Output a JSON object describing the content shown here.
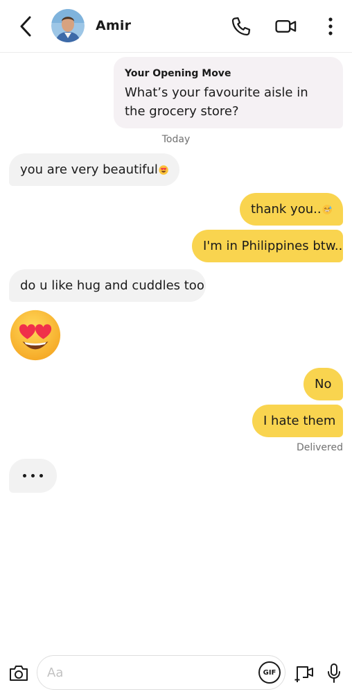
{
  "header": {
    "contact_name": "Amir",
    "icons": {
      "back": "chevron-left-icon",
      "call": "phone-icon",
      "video": "video-camera-icon",
      "more": "more-vertical-icon"
    }
  },
  "opening_move": {
    "label": "Your Opening Move",
    "question": "What’s your favourite aisle in the grocery store?"
  },
  "date_separator": "Today",
  "messages": [
    {
      "direction": "incoming",
      "text": "you are very beautiful",
      "emoji": "heart-eyes"
    },
    {
      "direction": "outgoing",
      "text": "thank you..",
      "emoji": "grinning-sweat"
    },
    {
      "direction": "outgoing",
      "text": "I'm in Philippines btw.."
    },
    {
      "direction": "incoming",
      "text": "do u like hug and cuddles too"
    },
    {
      "direction": "incoming",
      "emoji": "heart-eyes",
      "large": true
    },
    {
      "direction": "outgoing",
      "text": "No"
    },
    {
      "direction": "outgoing",
      "text": "I hate them"
    }
  ],
  "status": "Delivered",
  "composer": {
    "placeholder": "Aa",
    "gif_label": "GIF",
    "icons": {
      "camera": "camera-icon",
      "gif": "gif-icon",
      "video_note": "video-note-icon",
      "mic": "microphone-icon"
    }
  },
  "colors": {
    "outgoing_bubble": "#f9d44f",
    "incoming_bubble": "#f2f2f2",
    "opening_move_bg": "#f5f1f4"
  }
}
